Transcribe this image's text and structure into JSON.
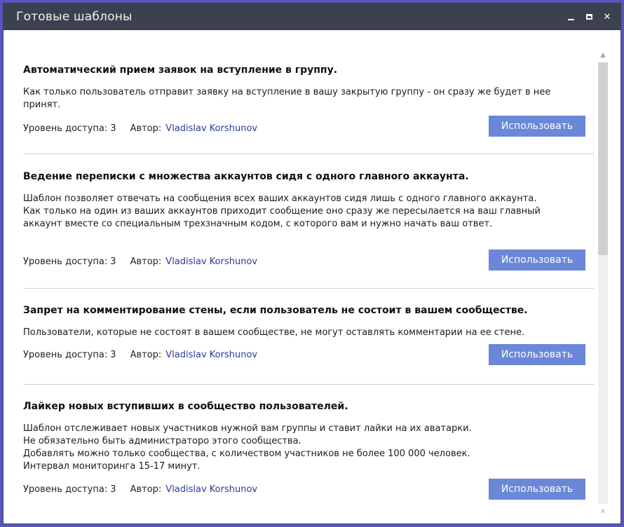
{
  "window": {
    "title": "Готовые шаблоны",
    "controls": {
      "minimize": "",
      "maximize": "",
      "close": "✕"
    }
  },
  "templates": [
    {
      "title": "Автоматический прием заявок на вступление в группу.",
      "description": [
        "Как только пользователь отправит заявку на вступление в вашу закрытую группу - он сразу же будет в нее",
        "принят."
      ],
      "level_label": "Уровень доступа:",
      "level_value": "3",
      "author_label": "Автор:",
      "author_name": "Vladislav Korshunov",
      "button_label": "Использовать"
    },
    {
      "title": "Ведение переписки с множества аккаунтов сидя с одного главного аккаунта.",
      "description": [
        "Шаблон позволяет отвечать на сообщения всех ваших аккаунтов сидя лишь с одного главного аккаунта.",
        "Как только на один из ваших аккаунтов приходит сообщение оно сразу же пересылается на ваш главный",
        "аккаунт вместе со специальным трехзначным кодом, с которого вам и нужно начать ваш ответ."
      ],
      "level_label": "Уровень доступа:",
      "level_value": "3",
      "author_label": "Автор:",
      "author_name": "Vladislav Korshunov",
      "button_label": "Использовать"
    },
    {
      "title": "Запрет на комментирование стены, если пользователь не состоит в вашем сообществе.",
      "description": [
        "Пользователи, которые не состоят в вашем сообществе, не могут оставлять комментарии на ее стене."
      ],
      "level_label": "Уровень доступа:",
      "level_value": "3",
      "author_label": "Автор:",
      "author_name": "Vladislav Korshunov",
      "button_label": "Использовать"
    },
    {
      "title": "Лайкер новых вступивших в сообщество пользователей.",
      "description": [
        "Шаблон отслеживает новых участников нужной вам группы и ставит лайки на их аватарки.",
        "Не обязательно быть администраторо этого сообщества.",
        "Добавлять можно только сообщества, с количеством участников не более 100 000 человек.",
        "Интервал мониторинга 15-17 минут."
      ],
      "level_label": "Уровень доступа:",
      "level_value": "3",
      "author_label": "Автор:",
      "author_name": "Vladislav Korshunov",
      "button_label": "Использовать"
    }
  ],
  "scrollbar": {
    "up_arrow": "▲",
    "down_arrow": "✕"
  },
  "colors": {
    "titlebar": "#3c4150",
    "button": "#6b87d8",
    "author_link": "#2a3b9c"
  }
}
